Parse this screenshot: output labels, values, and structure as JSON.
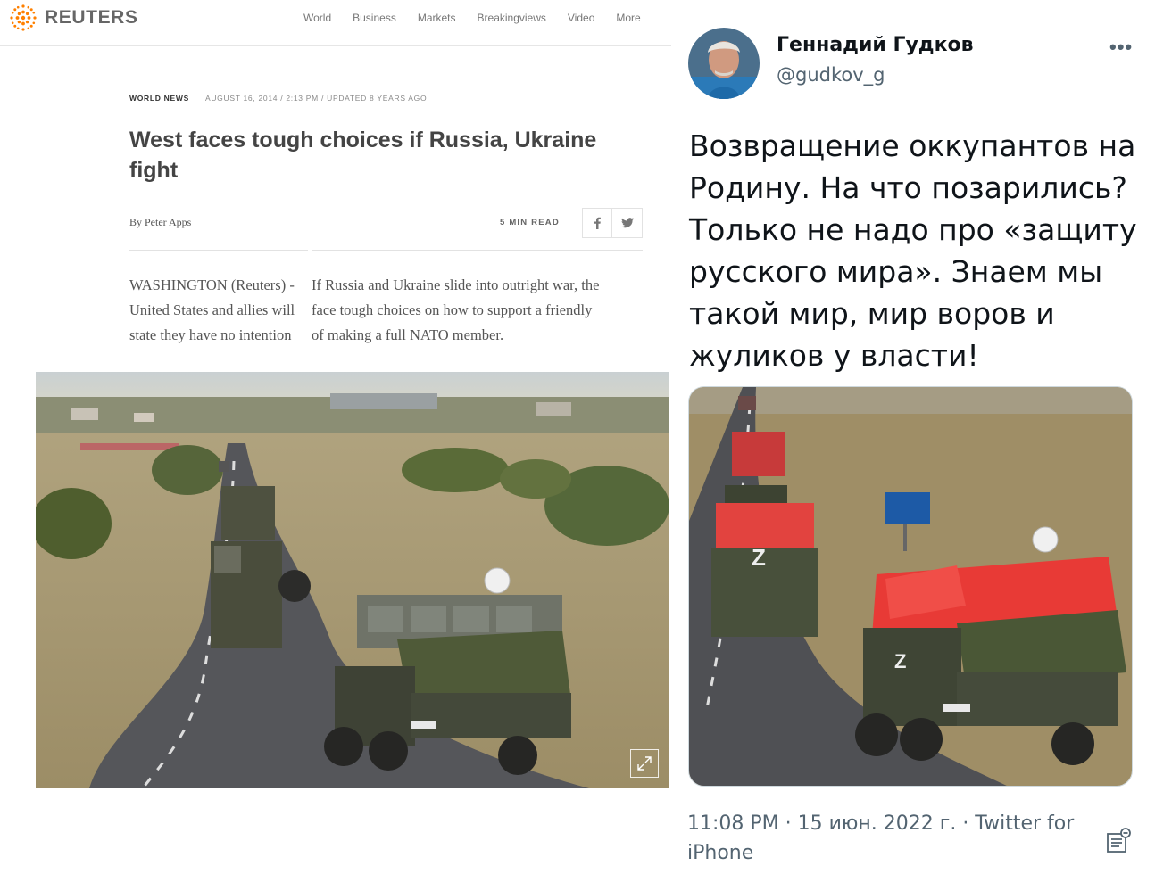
{
  "reuters": {
    "logo_text": "REUTERS",
    "nav": [
      "World",
      "Business",
      "Markets",
      "Breakingviews",
      "Video",
      "More"
    ],
    "kicker": "WORLD NEWS",
    "dateline": "AUGUST 16, 2014 / 2:13 PM / UPDATED 8 YEARS AGO",
    "headline": "West faces tough choices if Russia, Ukraine fight",
    "byline": "By Peter Apps",
    "read_time": "5 MIN READ",
    "body_col1": [
      "WASHINGTON (Reuters) -",
      "United States and allies will",
      "state they have no intention"
    ],
    "body_col2": [
      "If Russia and Ukraine slide into outright war, the",
      "face tough choices on how to support a friendly",
      "of making a full NATO member."
    ],
    "share_icons": [
      "facebook-icon",
      "twitter-icon"
    ],
    "brand_color": "#ff8000"
  },
  "tweet": {
    "name": "Геннадий Гудков",
    "handle": "@gudkov_g",
    "more": "•••",
    "text": "Возвращение оккупантов на Родину. На что позарились? Только не надо про «защиту русского мира». Знаем мы такой мир, мир воров и жуликов у власти!",
    "timestamp": "11:08 PM · 15 июн. 2022 г. · Twitter for iPhone",
    "text_color": "#0f1419",
    "secondary_color": "#536471"
  }
}
